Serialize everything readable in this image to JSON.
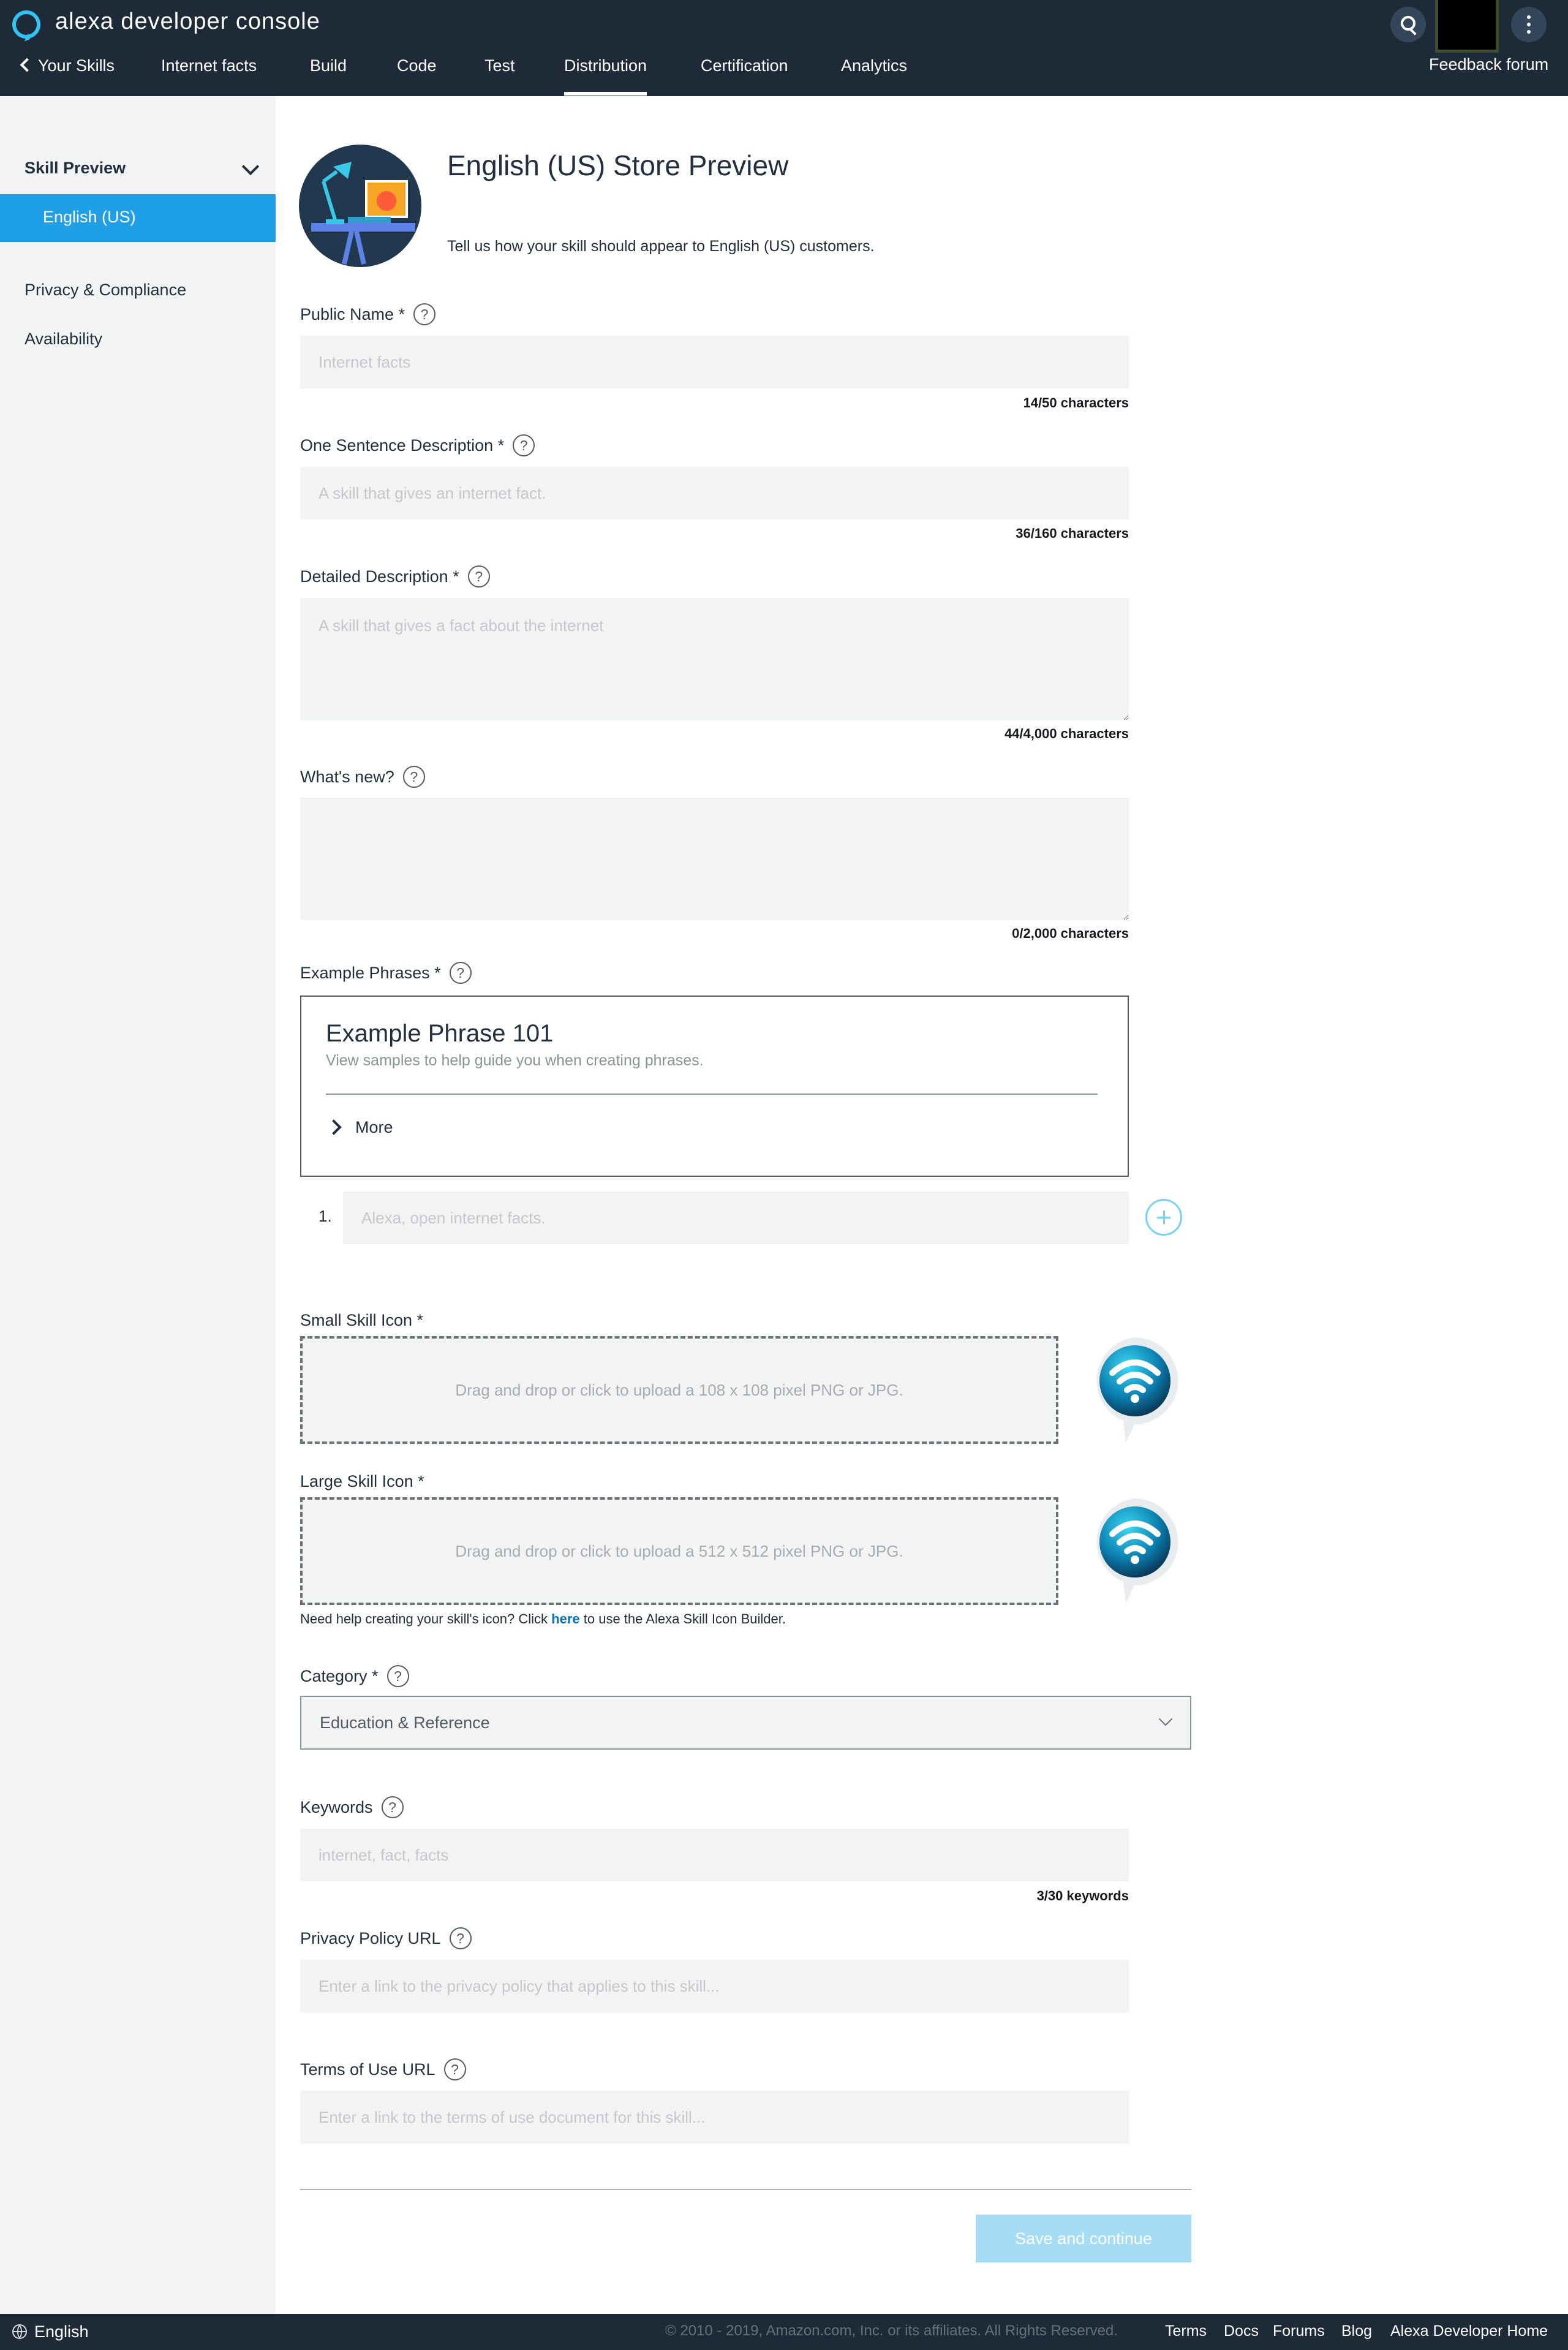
{
  "header": {
    "brand": "alexa developer console",
    "nav": [
      {
        "label": "Your Skills"
      },
      {
        "label": "Internet facts"
      },
      {
        "label": "Build"
      },
      {
        "label": "Code"
      },
      {
        "label": "Test"
      },
      {
        "label": "Distribution",
        "active": true
      },
      {
        "label": "Certification"
      },
      {
        "label": "Analytics"
      }
    ],
    "feedback": "Feedback forum",
    "icons": [
      "alexa-ring-icon",
      "search-icon",
      "more-vertical-icon"
    ]
  },
  "sidebar": {
    "section": "Skill Preview",
    "active_item": "English (US)",
    "links": [
      "Privacy & Compliance",
      "Availability"
    ]
  },
  "main": {
    "title": "English (US) Store Preview",
    "subtitle": "Tell us how your skill should appear to English (US) customers.",
    "fields": {
      "public_name": {
        "label": "Public Name *",
        "placeholder": "Internet facts",
        "counter": "14/50 characters"
      },
      "one_sentence": {
        "label": "One Sentence Description *",
        "placeholder": "A skill that gives an internet fact.",
        "counter": "36/160 characters"
      },
      "detailed": {
        "label": "Detailed Description *",
        "placeholder": "A skill that gives a fact about the internet",
        "counter": "44/4,000 characters"
      },
      "whats_new": {
        "label": "What's new?",
        "placeholder": "",
        "counter": "0/2,000 characters"
      },
      "example_phrases": {
        "label": "Example Phrases *",
        "box_title": "Example Phrase 101",
        "box_subtitle": "View samples to help guide you when creating phrases.",
        "more": "More",
        "items": [
          {
            "number": "1.",
            "placeholder": "Alexa, open internet facts."
          }
        ]
      },
      "small_icon": {
        "label": "Small Skill Icon *",
        "drop_text": "Drag and drop or click to upload a 108 x 108 pixel PNG or JPG."
      },
      "large_icon": {
        "label": "Large Skill Icon *",
        "drop_text": "Drag and drop or click to upload a 512 x 512 pixel PNG or JPG."
      },
      "icon_help": {
        "before": "Need help creating your skill's icon? Click ",
        "link": "here",
        "after": " to use the Alexa Skill Icon Builder."
      },
      "category": {
        "label": "Category *",
        "value": "Education & Reference"
      },
      "keywords": {
        "label": "Keywords",
        "placeholder": "internet, fact, facts",
        "counter": "3/30 keywords"
      },
      "privacy_url": {
        "label": "Privacy Policy URL",
        "placeholder": "Enter a link to the privacy policy that applies to this skill..."
      },
      "terms_url": {
        "label": "Terms of Use URL",
        "placeholder": "Enter a link to the terms of use document for this skill..."
      }
    },
    "help_glyph": "?",
    "save_button": "Save and continue"
  },
  "footer": {
    "language": "English",
    "copyright": "© 2010 - 2019, Amazon.com, Inc. or its affiliates. All Rights Reserved.",
    "links": [
      "Terms",
      "Docs",
      "Forums",
      "Blog",
      "Alexa Developer Home"
    ]
  },
  "colors": {
    "header_bg": "#1e2a38",
    "accent": "#1fa0e6",
    "alexa_blue": "#31c4f3",
    "save_disabled": "#a6ddf6",
    "link": "#0073bb"
  }
}
